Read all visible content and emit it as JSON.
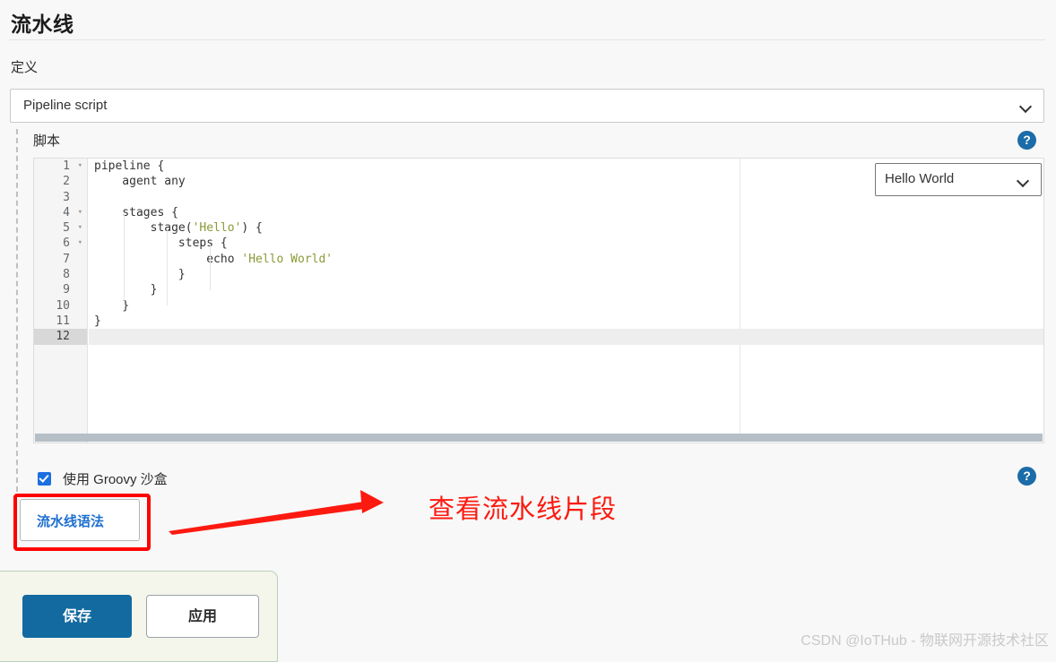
{
  "page": {
    "title": "流水线",
    "definition_label": "定义",
    "script_label": "脚本",
    "watermark": "CSDN @IoTHub - 物联网开源技术社区"
  },
  "definition_select": {
    "value": "Pipeline script",
    "chevron_icon": "chevron-down-icon"
  },
  "snippet_select": {
    "value": "Hello World",
    "chevron_icon": "chevron-down-icon"
  },
  "help": {
    "icon": "question-help-icon",
    "glyph": "?"
  },
  "editor": {
    "active_line": 12,
    "line_numbers": [
      "1",
      "2",
      "3",
      "4",
      "5",
      "6",
      "7",
      "8",
      "9",
      "10",
      "11",
      "12"
    ],
    "fold_lines": [
      1,
      4,
      5,
      6
    ],
    "fold_glyph": "▾",
    "lines": [
      "pipeline {",
      "    agent any",
      "",
      "    stages {",
      "        stage('Hello') {",
      "            steps {",
      "                echo 'Hello World'",
      "            }",
      "        }",
      "    }",
      "}",
      ""
    ],
    "string_color": "#8a9a36",
    "scrollbar": "horizontal-scrollbar"
  },
  "sandbox": {
    "checked": true,
    "label": "使用 Groovy 沙盒",
    "checkbox_color": "#1c6fe0"
  },
  "syntax_link": {
    "label": "流水线语法",
    "color": "#1d6fd0"
  },
  "annotation": {
    "text": "查看流水线片段",
    "color": "#fc1a10",
    "arrow_icon": "red-arrow-icon",
    "highlight_box_color": "#ff0000"
  },
  "actions": {
    "save_label": "保存",
    "apply_label": "应用",
    "save_color": "#136aa0"
  }
}
